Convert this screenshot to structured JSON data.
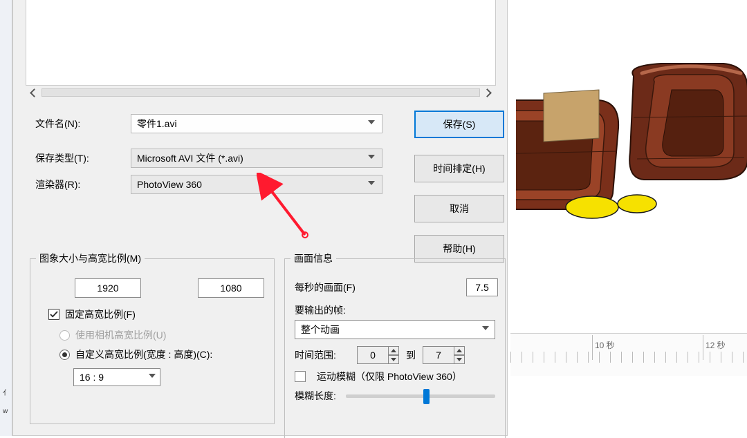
{
  "labels": {
    "filename": "文件名(N):",
    "savetype": "保存类型(T):",
    "renderer": "渲染器(R):"
  },
  "values": {
    "filename": "零件1.avi",
    "savetype": "Microsoft AVI 文件 (*.avi)",
    "renderer": "PhotoView 360"
  },
  "buttons": {
    "save": "保存(S)",
    "schedule": "时间排定(H)",
    "cancel": "取消",
    "help": "帮助(H)"
  },
  "image_group": {
    "legend": "图象大小与高宽比例(M)",
    "width": "1920",
    "height": "1080",
    "lock_aspect": "固定高宽比例(F)",
    "use_camera": "使用相机高宽比例(U)",
    "custom_ratio": "自定义高宽比例(宽度 : 高度)(C):",
    "ratio_value": "16 : 9"
  },
  "frame_group": {
    "legend": "画面信息",
    "fps_label": "每秒的画面(F)",
    "fps_value": "7.5",
    "frames_out_label": "要输出的帧:",
    "frames_out_value": "整个动画",
    "time_range_label": "时间范围:",
    "time_from": "0",
    "time_to_label": "到",
    "time_to": "7",
    "motion_blur": "运动模糊（仅限 PhotoView 360）",
    "blur_len_label": "模糊长度:"
  },
  "timeline": {
    "tick10": "10 秒",
    "tick12": "12 秒"
  },
  "sliver": {
    "char1": "亻",
    "char2": "w"
  }
}
